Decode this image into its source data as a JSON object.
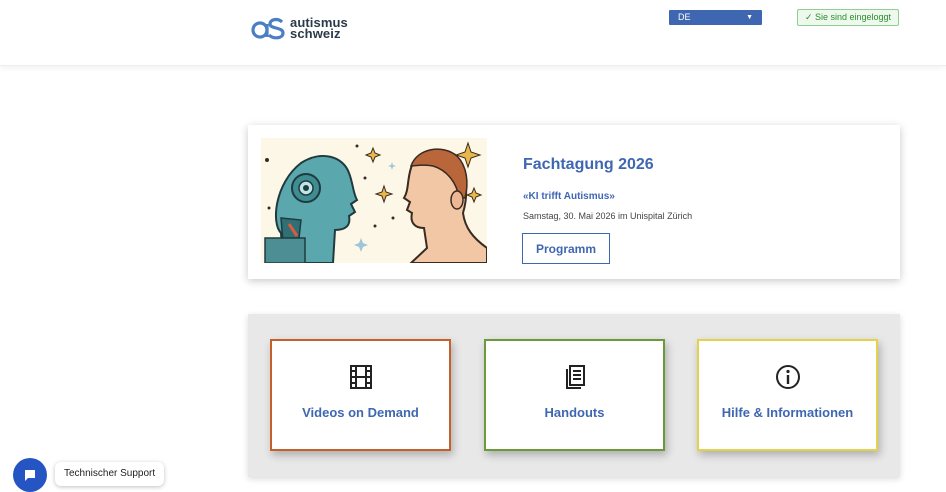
{
  "header": {
    "logo_line1": "autismus",
    "logo_line2": "schweiz",
    "language": "DE",
    "login_status": "✓ Sie sind eingeloggt"
  },
  "event": {
    "title": "Fachtagung 2026",
    "subtitle": "«KI trifft Autismus»",
    "meta": "Samstag, 30. Mai 2026 im Unispital Zürich",
    "button": "Programm"
  },
  "tiles": [
    {
      "label": "Videos on Demand",
      "icon": "film-icon",
      "color": "#c6602a"
    },
    {
      "label": "Handouts",
      "icon": "document-icon",
      "color": "#6a9a3a"
    },
    {
      "label": "Hilfe & Informationen",
      "icon": "info-icon",
      "color": "#e4d24a"
    }
  ],
  "support": {
    "label": "Technischer Support"
  },
  "colors": {
    "accent": "#3f67b1",
    "support": "#2455c3"
  }
}
